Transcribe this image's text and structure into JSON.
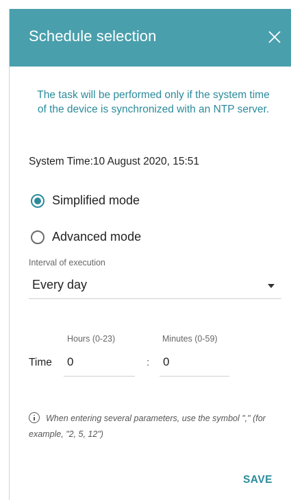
{
  "dialog": {
    "title": "Schedule selection",
    "close_icon": "close-icon"
  },
  "notice": "The task will be performed only if the system time of the device is synchronized with an NTP server.",
  "system_time": "System Time:10 August 2020, 15:51",
  "mode": {
    "options": [
      {
        "label": "Simplified mode",
        "selected": true
      },
      {
        "label": "Advanced mode",
        "selected": false
      }
    ]
  },
  "interval": {
    "label": "Interval of execution",
    "value": "Every day"
  },
  "time": {
    "label": "Time",
    "hours_label": "Hours (0-23)",
    "hours_value": "0",
    "separator": ":",
    "minutes_label": "Minutes (0-59)",
    "minutes_value": "0"
  },
  "hint": "When entering several parameters, use the symbol \",\" (for example, \"2, 5, 12\")",
  "save_label": "SAVE",
  "colors": {
    "header": "#4a9fac",
    "accent": "#2b8b9b"
  }
}
